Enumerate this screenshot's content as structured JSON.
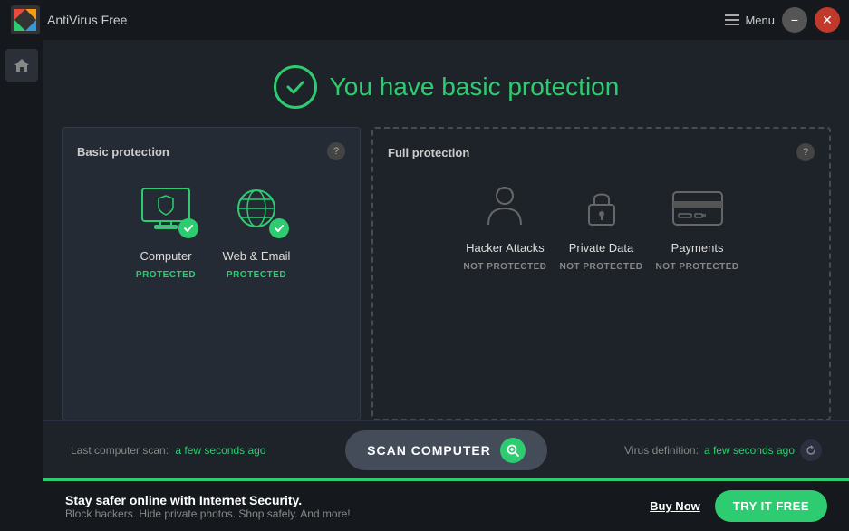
{
  "titlebar": {
    "app_name": "AntiVirus Free",
    "menu_label": "Menu",
    "minimize_label": "−",
    "close_label": "✕"
  },
  "header": {
    "status_text": "You have basic protection"
  },
  "basic_panel": {
    "title": "Basic protection",
    "help": "?",
    "items": [
      {
        "name": "Computer",
        "status": "PROTECTED",
        "protected": true
      },
      {
        "name": "Web & Email",
        "status": "PROTECTED",
        "protected": true
      }
    ]
  },
  "full_panel": {
    "title": "Full protection",
    "help": "?",
    "items": [
      {
        "name": "Hacker Attacks",
        "status": "NOT PROTECTED"
      },
      {
        "name": "Private Data",
        "status": "NOT PROTECTED"
      },
      {
        "name": "Payments",
        "status": "NOT PROTECTED"
      }
    ]
  },
  "bottom": {
    "last_scan_label": "Last computer scan:",
    "last_scan_value": "a few seconds ago",
    "scan_button": "SCAN COMPUTER",
    "virus_def_label": "Virus definition:",
    "virus_def_value": "a few seconds ago"
  },
  "promo": {
    "title": "Stay safer online with Internet Security.",
    "subtitle": "Block hackers. Hide private photos. Shop safely. And more!",
    "buy_label": "Buy Now",
    "try_label": "TRY IT FREE"
  }
}
